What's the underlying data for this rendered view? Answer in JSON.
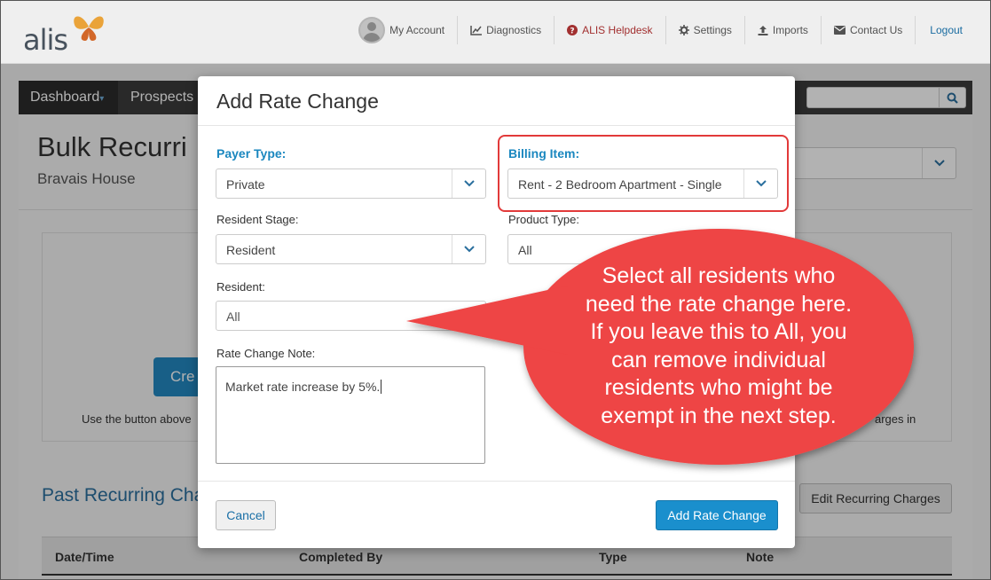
{
  "brand": {
    "name": "alis"
  },
  "topnav": {
    "my_account": "My Account",
    "diagnostics": "Diagnostics",
    "helpdesk": "ALIS Helpdesk",
    "settings": "Settings",
    "imports": "Imports",
    "contact": "Contact Us",
    "logout": "Logout"
  },
  "mainnav": {
    "dashboard": "Dashboard",
    "prospects": "Prospects"
  },
  "page": {
    "title": "Bulk Recurri",
    "subtitle": "Bravais House",
    "create_button": "Cre",
    "help_left": "Use the button above",
    "help_right": "arges in",
    "past_title": "Past Recurring Cha",
    "edit_button": "Edit Recurring Charges",
    "table_headers": [
      "Date/Time",
      "Completed By",
      "Type",
      "Note"
    ]
  },
  "modal": {
    "title": "Add Rate Change",
    "payer_type": {
      "label": "Payer Type:",
      "value": "Private"
    },
    "billing_item": {
      "label": "Billing Item:",
      "value": "Rent - 2 Bedroom Apartment - Single"
    },
    "resident_stage": {
      "label": "Resident Stage:",
      "value": "Resident"
    },
    "product_type": {
      "label": "Product Type:",
      "value": "All"
    },
    "resident": {
      "label": "Resident:",
      "value": "All"
    },
    "rate_change_note": {
      "label": "Rate Change Note:",
      "value": "Market rate increase by 5%."
    },
    "cancel": "Cancel",
    "add": "Add Rate Change"
  },
  "callout": {
    "lines": [
      "Select all residents who",
      "need the rate change here.",
      "If you leave this to All, you",
      "can remove individual",
      "residents who might be",
      "exempt in the next step."
    ]
  },
  "colors": {
    "accent": "#1a87bf",
    "primary_button": "#1a8fcd",
    "callout_red": "#ee4444",
    "highlight_red": "#e23a3a",
    "nav_dark": "#3c3c3c"
  }
}
